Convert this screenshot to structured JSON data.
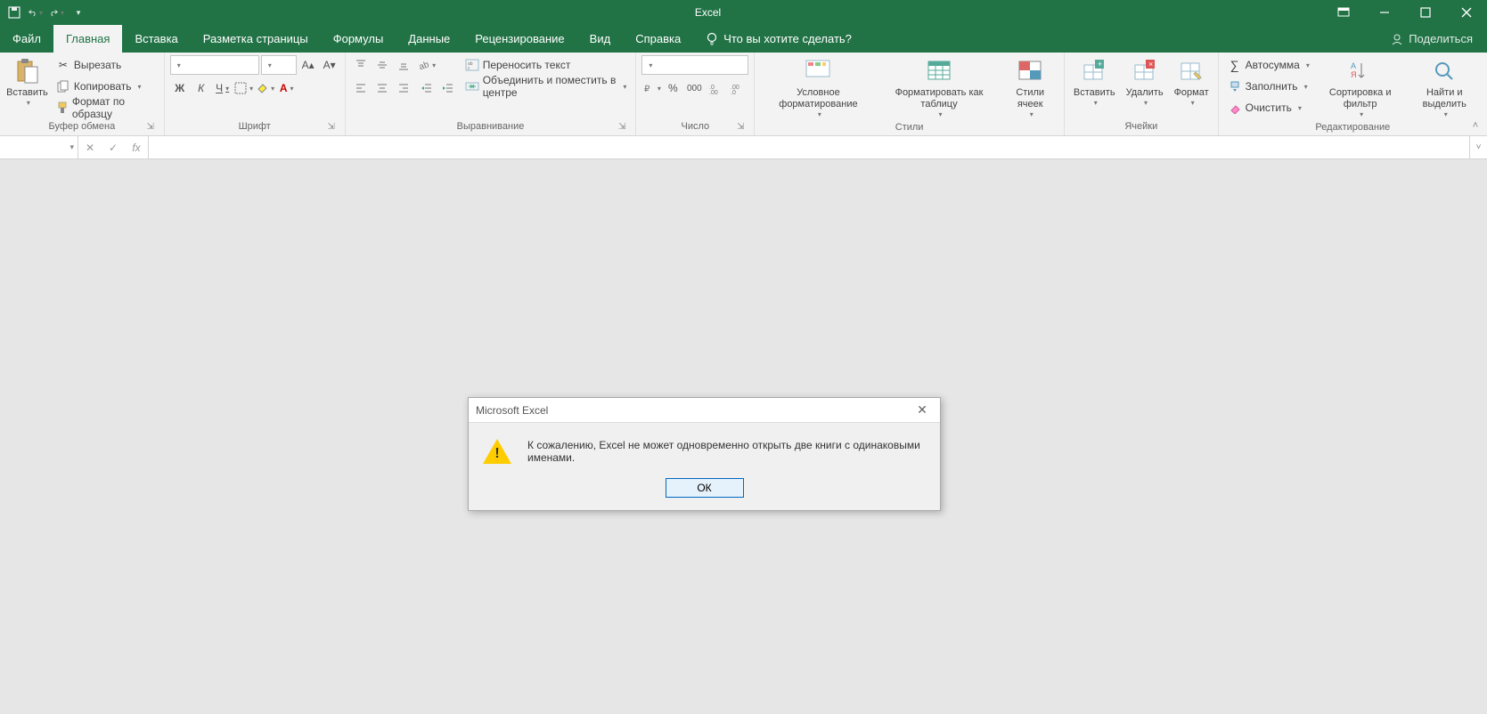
{
  "title": "Excel",
  "share": "Поделиться",
  "tabs": {
    "file": "Файл",
    "home": "Главная",
    "insert": "Вставка",
    "page_layout": "Разметка страницы",
    "formulas": "Формулы",
    "data": "Данные",
    "review": "Рецензирование",
    "view": "Вид",
    "help": "Справка",
    "tell_me": "Что вы хотите сделать?"
  },
  "ribbon": {
    "clipboard": {
      "label": "Буфер обмена",
      "paste": "Вставить",
      "cut": "Вырезать",
      "copy": "Копировать",
      "format_painter": "Формат по образцу"
    },
    "font": {
      "label": "Шрифт",
      "name": "",
      "size": "",
      "bold": "Ж",
      "italic": "К",
      "underline": "Ч"
    },
    "alignment": {
      "label": "Выравнивание",
      "wrap": "Переносить текст",
      "merge": "Объединить и поместить в центре"
    },
    "number": {
      "label": "Число",
      "format": ""
    },
    "styles": {
      "label": "Стили",
      "conditional": "Условное форматирование",
      "as_table": "Форматировать как таблицу",
      "cell_styles": "Стили ячеек"
    },
    "cells": {
      "label": "Ячейки",
      "insert": "Вставить",
      "delete": "Удалить",
      "format": "Формат"
    },
    "editing": {
      "label": "Редактирование",
      "autosum": "Автосумма",
      "fill": "Заполнить",
      "clear": "Очистить",
      "sort_filter": "Сортировка и фильтр",
      "find_select": "Найти и выделить"
    }
  },
  "formula_bar": {
    "name_box": "",
    "formula": ""
  },
  "dialog": {
    "title": "Microsoft Excel",
    "message": "К сожалению, Excel не может одновременно открыть две книги с одинаковыми именами.",
    "ok": "ОК"
  }
}
